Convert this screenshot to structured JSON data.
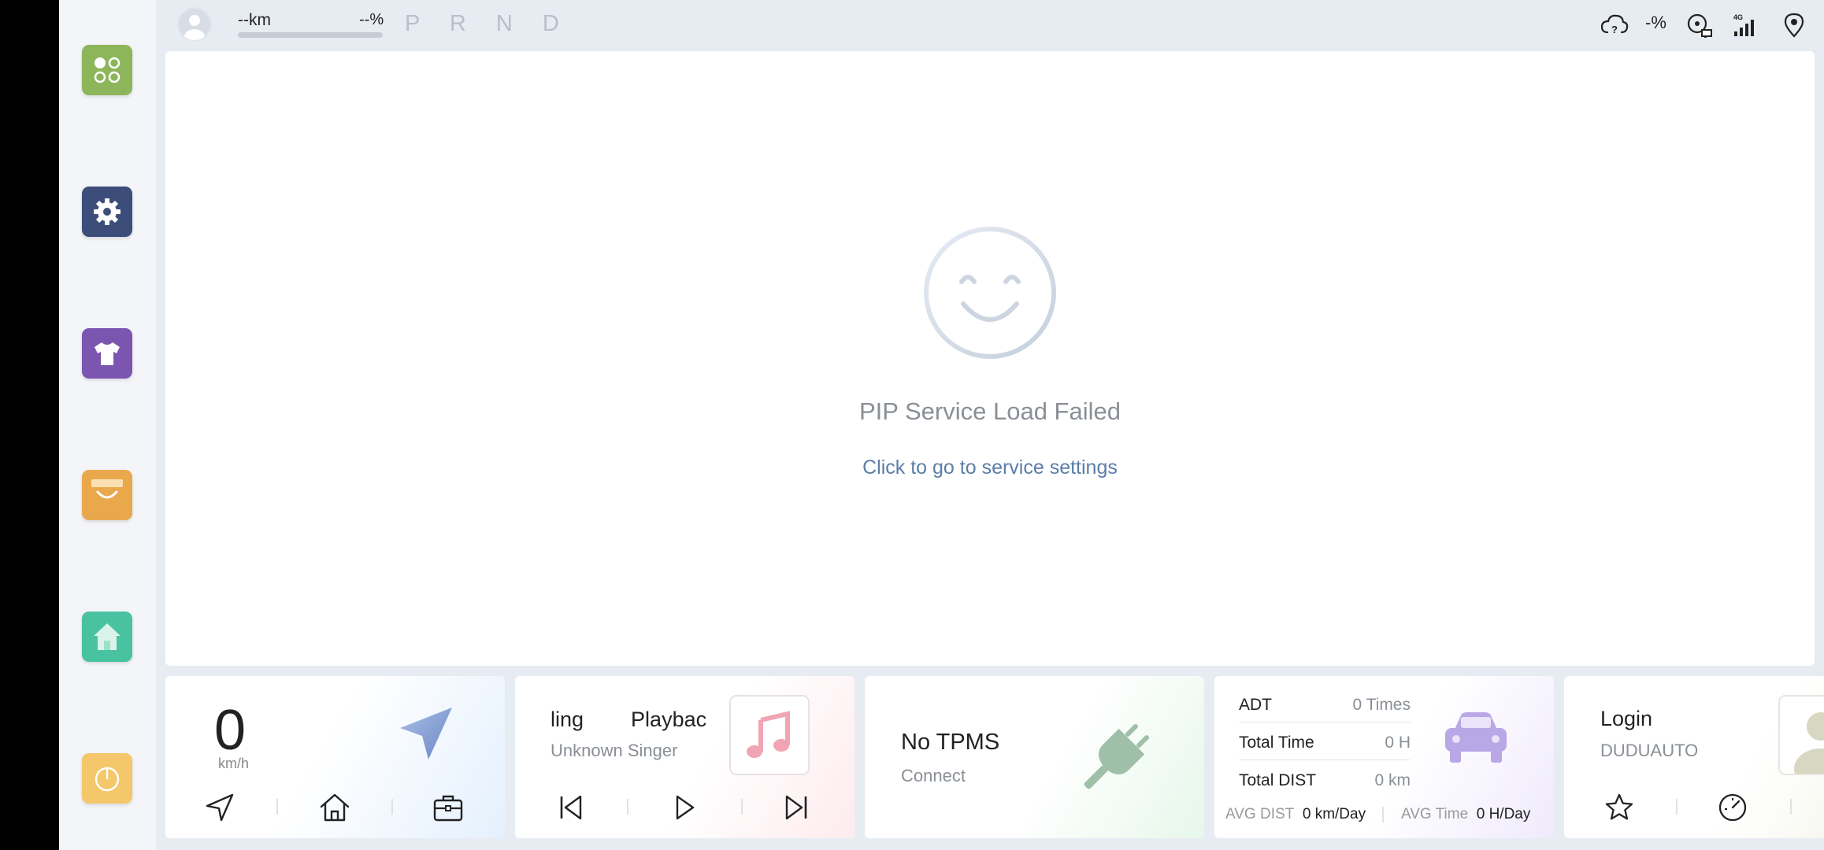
{
  "status_bar": {
    "range": "--km",
    "battery": "--%",
    "gears": "P R N D",
    "cloud_percent": "-%",
    "signal_label": "4G"
  },
  "sidebar": {
    "apps": [
      {
        "name": "apps-grid",
        "color": "#8db55a"
      },
      {
        "name": "settings",
        "color": "#3d4d79"
      },
      {
        "name": "themes",
        "color": "#7b55b0"
      },
      {
        "name": "store",
        "color": "#eaa84c"
      },
      {
        "name": "home",
        "color": "#48c2a0"
      },
      {
        "name": "power",
        "color": "#f4c76a"
      }
    ]
  },
  "pip": {
    "title": "PIP Service Load Failed",
    "link": "Click to go to service settings"
  },
  "nav_widget": {
    "speed": "0",
    "unit": "km/h"
  },
  "music_widget": {
    "song": "ling        Playbac",
    "singer": "Unknown Singer"
  },
  "tpms_widget": {
    "title": "No TPMS",
    "subtitle": "Connect"
  },
  "stats_widget": {
    "rows": [
      {
        "label": "ADT",
        "value": "0 Times"
      },
      {
        "label": "Total Time",
        "value": "0 H"
      },
      {
        "label": "Total DIST",
        "value": "0 km"
      }
    ],
    "avg_dist_label": "AVG DIST",
    "avg_dist_value": "0 km/Day",
    "avg_time_label": "AVG Time",
    "avg_time_value": "0 H/Day"
  },
  "login_widget": {
    "title": "Login",
    "subtitle": "DUDUAUTO"
  },
  "colors": {
    "accent_link": "#5b7ea8",
    "background": "#e7ecf3"
  }
}
